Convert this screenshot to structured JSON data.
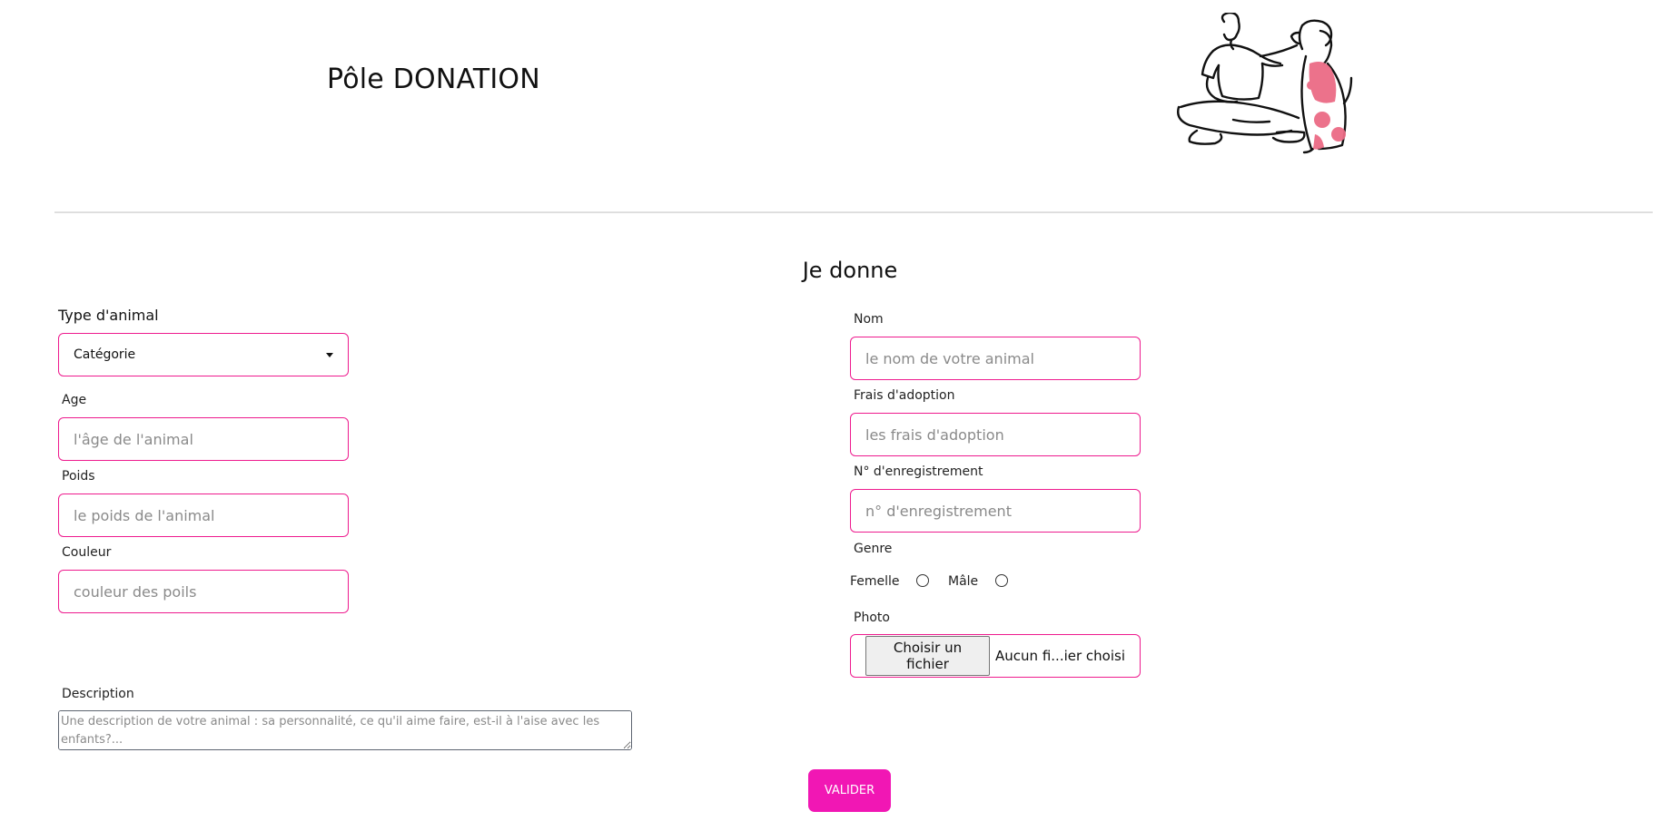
{
  "header": {
    "title": "Pôle DONATION"
  },
  "form": {
    "title": "Je donne",
    "left": {
      "type_label": "Type d'animal",
      "type_select_value": "Catégorie",
      "age_label": "Age",
      "age_placeholder": "l'âge de l'animal",
      "weight_label": "Poids",
      "weight_placeholder": "le poids de l'animal",
      "color_label": "Couleur",
      "color_placeholder": "couleur des poils",
      "description_label": "Description",
      "description_placeholder": "Une description de votre animal : sa personnalité, ce qu'il aime faire, est-il à l'aise avec les enfants?..."
    },
    "right": {
      "name_label": "Nom",
      "name_placeholder": "le nom de votre animal",
      "fee_label": "Frais d'adoption",
      "fee_placeholder": "les frais d'adoption",
      "reg_label": "N° d'enregistrement",
      "reg_placeholder": "n° d'enregistrement",
      "gender_label": "Genre",
      "female_label": "Femelle",
      "male_label": "Mâle",
      "photo_label": "Photo",
      "file_button": "Choisir un fichier",
      "file_status": "Aucun fi...ier choisi"
    },
    "submit_label": "VALIDER"
  },
  "colors": {
    "accent": "#ee1b8e",
    "button": "#f117b4",
    "illustration_pink": "#ec6b85"
  }
}
